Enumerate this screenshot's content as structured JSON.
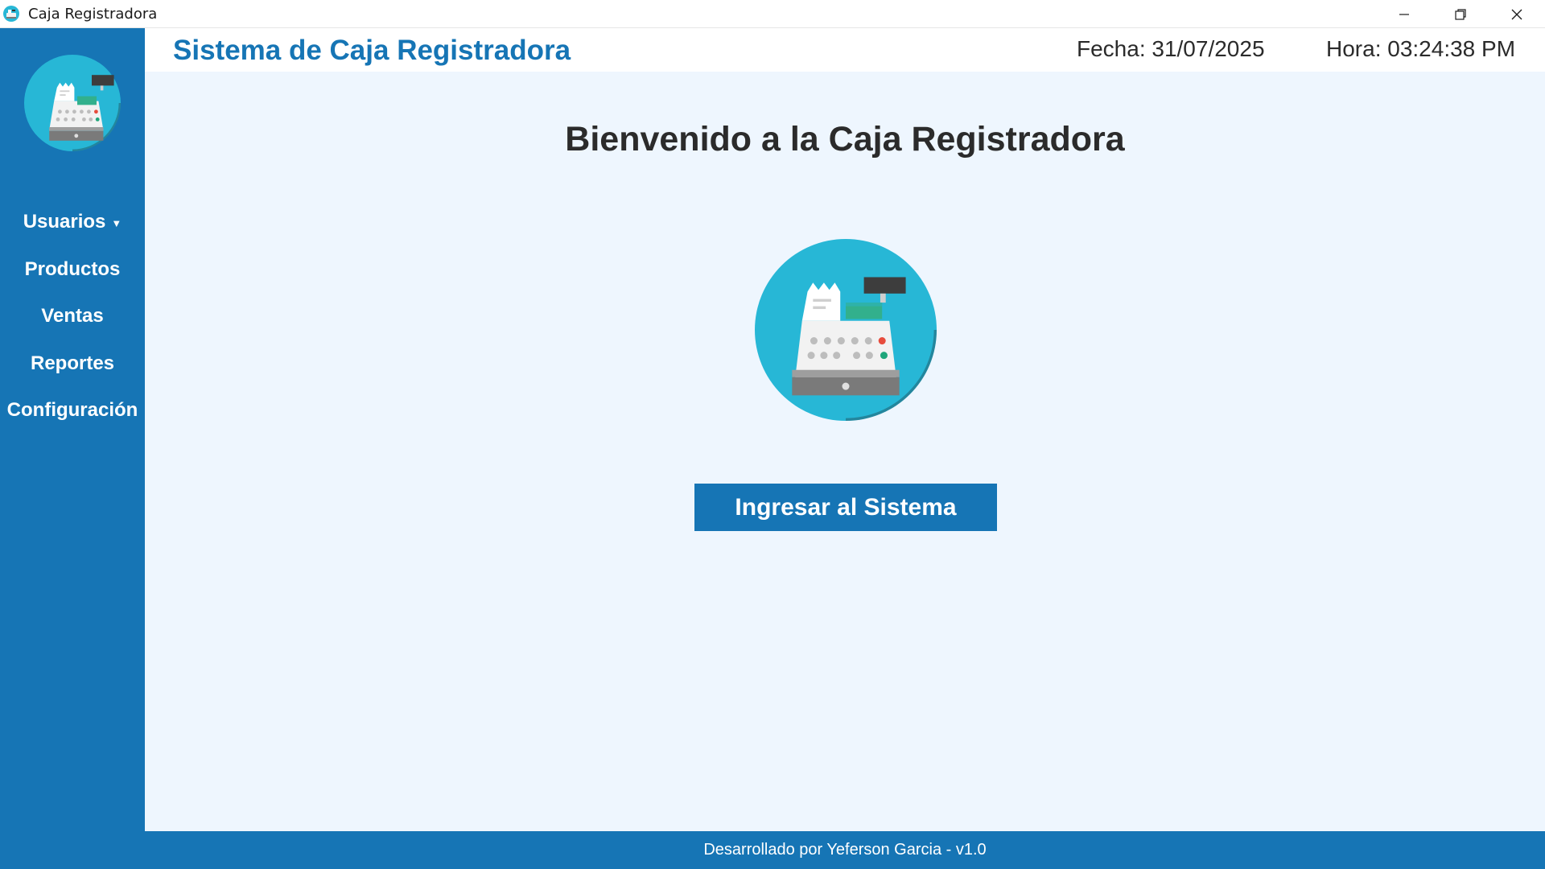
{
  "window": {
    "title": "Caja Registradora",
    "app_icon": "cash-register-icon",
    "controls": [
      "minimize-icon",
      "restore-icon",
      "close-icon"
    ]
  },
  "sidebar": {
    "logo": "cash-register-icon",
    "items": [
      {
        "label": "Usuarios",
        "has_dropdown": true
      },
      {
        "label": "Productos"
      },
      {
        "label": "Ventas"
      },
      {
        "label": "Reportes"
      },
      {
        "label": "Configuración"
      }
    ]
  },
  "header": {
    "title": "Sistema de Caja Registradora",
    "date": "Fecha: 31/07/2025",
    "time": "Hora: 03:24:38 PM"
  },
  "main": {
    "welcome": "Bienvenido a la Caja Registradora",
    "hero_icon": "cash-register-icon",
    "enter_button": "Ingresar al Sistema"
  },
  "footer": {
    "text": "Desarrollado por Yeferson Garcia - v1.0"
  },
  "colors": {
    "primary": "#1675b5",
    "background": "#eef6fe",
    "icon_circle": "#27b7d6",
    "text_dark": "#2b2b2b"
  }
}
